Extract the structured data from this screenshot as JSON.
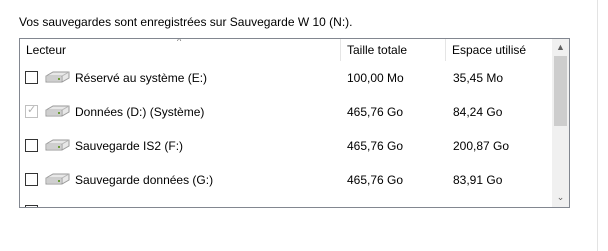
{
  "intro_text": "Vos sauvegardes sont enregistrées sur Sauvegarde W 10 (N:).",
  "columns": {
    "drive": "Lecteur",
    "total": "Taille totale",
    "used": "Espace utilisé"
  },
  "sort_indicator": "^",
  "rows": [
    {
      "name": "Réservé au système (E:)",
      "total": "100,00 Mo",
      "used": "35,45 Mo",
      "checked": false,
      "disabled": false
    },
    {
      "name": "Données (D:) (Système)",
      "total": "465,76 Go",
      "used": "84,24 Go",
      "checked": true,
      "disabled": true
    },
    {
      "name": "Sauvegarde IS2 (F:)",
      "total": "465,76 Go",
      "used": "200,87 Go",
      "checked": false,
      "disabled": false
    },
    {
      "name": "Sauvegarde données (G:)",
      "total": "465,76 Go",
      "used": "83,91 Go",
      "checked": false,
      "disabled": false
    }
  ],
  "scrollbar": {
    "up_glyph": "▲",
    "down_glyph": "⌄"
  },
  "icons": {
    "drive": "drive-icon",
    "check": "checkmark-icon"
  }
}
